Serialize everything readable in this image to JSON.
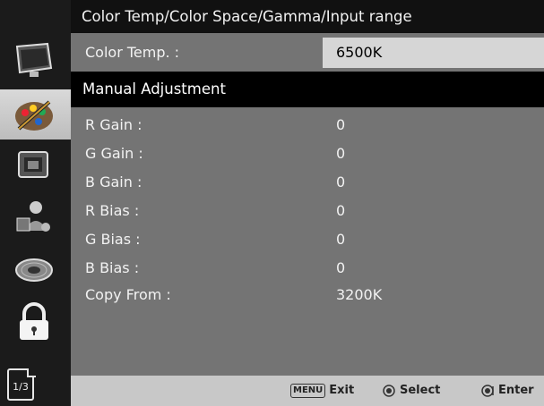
{
  "title": "Color Temp/Color Space/Gamma/Input range",
  "color_temp": {
    "label": "Color Temp. :",
    "value": "6500K"
  },
  "section": "Manual Adjustment",
  "rows": [
    {
      "label": "R Gain :",
      "value": "0"
    },
    {
      "label": "G Gain :",
      "value": "0"
    },
    {
      "label": "B Gain :",
      "value": "0"
    },
    {
      "label": "R Bias :",
      "value": "0"
    },
    {
      "label": "G Bias :",
      "value": "0"
    },
    {
      "label": "B Bias :",
      "value": "0"
    },
    {
      "label": "Copy From :",
      "value": "3200K"
    }
  ],
  "sidebar": {
    "icons": [
      "monitor-icon",
      "color-palette-icon",
      "picture-in-picture-icon",
      "user-settings-icon",
      "disc-icon",
      "lock-icon"
    ],
    "active_index": 1,
    "page": "1/3"
  },
  "footer": {
    "menu_key": "MENU",
    "exit_label": "Exit",
    "select_label": "Select",
    "enter_label": "Enter"
  },
  "colors": {
    "panel": "#747474",
    "title_bar": "#111111",
    "highlight": "#d6d6d6",
    "footer": "#c8c8c8"
  }
}
